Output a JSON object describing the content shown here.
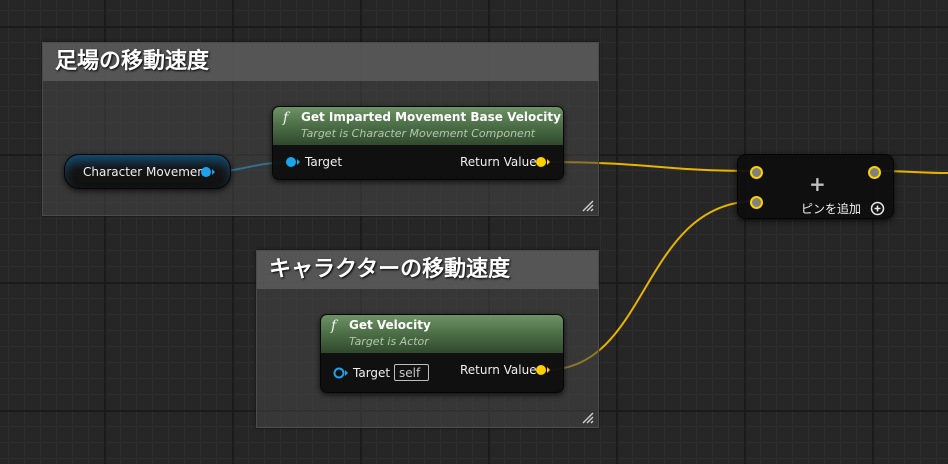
{
  "comments": {
    "base_velocity": {
      "title": "足場の移動速度"
    },
    "character_velocity": {
      "title": "キャラクターの移動速度"
    }
  },
  "nodes": {
    "character_movement": {
      "label": "Character Movement"
    },
    "get_imparted_velocity": {
      "icon": "function-icon",
      "icon_glyph": "f",
      "title": "Get Imparted Movement Base Velocity",
      "subtitle": "Target is Character Movement Component",
      "input_label": "Target",
      "output_label": "Return Value"
    },
    "get_velocity": {
      "icon": "function-icon",
      "icon_glyph": "f",
      "title": "Get Velocity",
      "subtitle": "Target is Actor",
      "input_label": "Target",
      "input_value": "self",
      "output_label": "Return Value"
    },
    "add_node": {
      "operator": "+",
      "add_pin_label": "ピンを追加",
      "add_pin_icon": "plus-circle-icon"
    }
  },
  "colors": {
    "object_pin": "#1ba4ec",
    "vector_pin": "#fdd000",
    "function_header": "#486a43"
  }
}
